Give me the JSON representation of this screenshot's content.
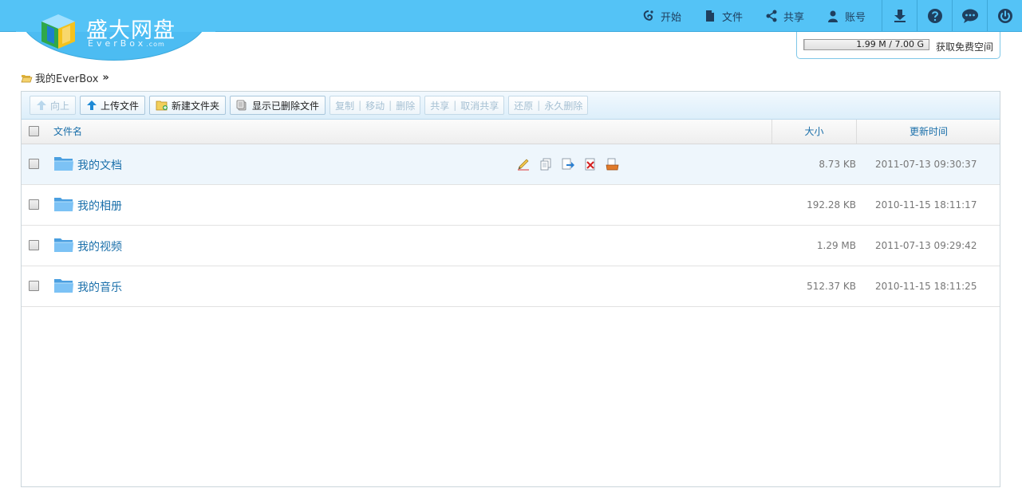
{
  "app": {
    "logo_cn": "盛大网盘",
    "logo_en": "EverBox",
    "logo_domain": ".com"
  },
  "nav": {
    "items": [
      {
        "label": "开始",
        "icon": "start-icon"
      },
      {
        "label": "文件",
        "icon": "file-icon"
      },
      {
        "label": "共享",
        "icon": "share-icon"
      },
      {
        "label": "账号",
        "icon": "user-icon"
      }
    ],
    "icons": [
      "download-icon",
      "help-icon",
      "chat-icon",
      "power-icon"
    ]
  },
  "quota": {
    "used_text": "1.99 M / 7.00 G",
    "used_fraction": 0.0003,
    "link": "获取免费空间"
  },
  "breadcrumb": {
    "path": "我的EverBox",
    "separator": "»"
  },
  "toolbar": {
    "up": "向上",
    "upload": "上传文件",
    "new_folder": "新建文件夹",
    "show_deleted": "显示已删除文件",
    "group1": [
      "复制",
      "移动",
      "删除"
    ],
    "group2": [
      "共享",
      "取消共享"
    ],
    "group3": [
      "还原",
      "永久删除"
    ]
  },
  "table": {
    "headers": {
      "name": "文件名",
      "size": "大小",
      "time": "更新时间"
    },
    "rows": [
      {
        "name": "我的文档",
        "size": "8.73 KB",
        "time": "2011-07-13 09:30:37"
      },
      {
        "name": "我的相册",
        "size": "192.28 KB",
        "time": "2010-11-15 18:11:17"
      },
      {
        "name": "我的视频",
        "size": "1.29 MB",
        "time": "2011-07-13 09:29:42"
      },
      {
        "name": "我的音乐",
        "size": "512.37 KB",
        "time": "2010-11-15 18:11:25"
      }
    ]
  },
  "row_actions": [
    "edit-icon",
    "copy-icon",
    "move-icon",
    "delete-icon",
    "share-folder-icon"
  ],
  "colors": {
    "topbar": "#54c3f6",
    "link": "#1a6faa",
    "disabled": "#a6c0d3"
  }
}
